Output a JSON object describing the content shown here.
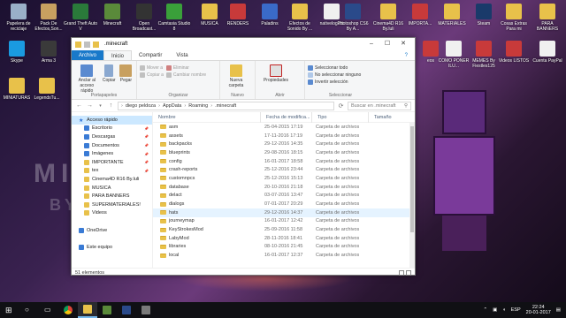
{
  "desktop": {
    "icons": [
      {
        "label": "Papelera de reciclaje",
        "color": "#9ab0c8"
      },
      {
        "label": "Pack De Efectos,Son...",
        "color": "#c8a060"
      },
      {
        "label": "Grand Theft Auto V",
        "color": "#2a7a3a"
      },
      {
        "label": "Minecraft",
        "color": "#5a8a3a"
      },
      {
        "label": "Open Broadcast...",
        "color": "#333333"
      },
      {
        "label": "Camtasia Studio 8",
        "color": "#3aa03a"
      },
      {
        "label": "MUSICA",
        "color": "#e8c14a"
      },
      {
        "label": "RENDERS",
        "color": "#c83a3a"
      },
      {
        "label": "Paladins",
        "color": "#3a6ac8"
      },
      {
        "label": "Efectos de Sonido By ...",
        "color": "#e8c14a"
      },
      {
        "label": "nativelog.txt",
        "color": "#f0f0f0"
      },
      {
        "label": "Photoshop CS6 By A...",
        "color": "#2a4a8a"
      },
      {
        "label": "Cinema4D R16 By.luli",
        "color": "#e8c14a"
      },
      {
        "label": "IMPORTA...",
        "color": "#c83a3a"
      },
      {
        "label": "MATERIALES",
        "color": "#e8c14a"
      },
      {
        "label": "Steam",
        "color": "#1a3a6a"
      },
      {
        "label": "Cosas Extras Para mi",
        "color": "#e8c14a"
      },
      {
        "label": "PARA BANNERS",
        "color": "#e8c14a"
      },
      {
        "label": "Skype",
        "color": "#1a9ae0"
      },
      {
        "label": "Arma 3",
        "color": "#3a3a3a"
      },
      {
        "label": "eos",
        "color": "#c83a3a"
      },
      {
        "label": "COMO PONER ILU...",
        "color": "#f0f0f0"
      },
      {
        "label": "MEMES By Fiestles125",
        "color": "#c83a3a"
      },
      {
        "label": "Videos LISTOS",
        "color": "#c83a3a"
      },
      {
        "label": "Cuenta PayPal",
        "color": "#f0f0f0"
      },
      {
        "label": "MINIATURAS",
        "color": "#e8c14a"
      },
      {
        "label": "LegendsTu...",
        "color": "#e8c14a"
      }
    ],
    "bg_text1": "MI",
    "bg_text2": "BY"
  },
  "window": {
    "title": ".minecraft",
    "controls": [
      "–",
      "☐",
      "✕"
    ],
    "tabs": [
      "Archivo",
      "Inicio",
      "Compartir",
      "Vista"
    ],
    "active_tab": "Inicio",
    "ribbon": {
      "portapapeles": {
        "name": "Portapapeles",
        "pin": "Anclar al acceso rápido",
        "copy": "Copiar",
        "paste": "Pegar",
        "cut": "✂"
      },
      "organizar": {
        "name": "Organizar",
        "move": "Mover a",
        "copy_to": "Copiar a",
        "delete": "Eliminar",
        "rename": "Cambiar nombre"
      },
      "nuevo": {
        "name": "Nuevo",
        "new_folder": "Nueva carpeta"
      },
      "abrir": {
        "name": "Abrir",
        "properties": "Propiedades"
      },
      "seleccionar": {
        "name": "Seleccionar",
        "all": "Seleccionar todo",
        "none": "No seleccionar ninguno",
        "invert": "Invertir selección"
      }
    },
    "address": {
      "segments": [
        "diego peldoza",
        "AppData",
        "Roaming",
        ".minecraft"
      ],
      "search_placeholder": "Buscar en .minecraft"
    },
    "nav": [
      {
        "label": "Acceso rápido",
        "type": "top",
        "sel": true
      },
      {
        "label": "Escritorio",
        "icon": "blue",
        "pin": true
      },
      {
        "label": "Descargas",
        "icon": "blue",
        "pin": true
      },
      {
        "label": "Documentos",
        "icon": "blue",
        "pin": true
      },
      {
        "label": "Imágenes",
        "icon": "blue",
        "pin": true
      },
      {
        "label": "IMPORTANTE",
        "icon": "folder",
        "pin": true
      },
      {
        "label": "tex",
        "icon": "folder",
        "pin": true
      },
      {
        "label": "Cinema4D R16 By.luli",
        "icon": "folder"
      },
      {
        "label": "MUSICA",
        "icon": "folder"
      },
      {
        "label": "PARA BANNERS",
        "icon": "folder"
      },
      {
        "label": "SUPERMATERIALES!",
        "icon": "folder"
      },
      {
        "label": "Videos",
        "icon": "folder"
      },
      {
        "label": "",
        "icon": "none"
      },
      {
        "label": "OneDrive",
        "type": "top",
        "icon": "blue"
      },
      {
        "label": "",
        "icon": "none"
      },
      {
        "label": "Este equipo",
        "type": "top",
        "icon": "blue"
      }
    ],
    "columns": [
      "Nombre",
      "Fecha de modifica...",
      "Tipo",
      "Tamaño"
    ],
    "files": [
      {
        "name": "asm",
        "date": "25-04-2015 17:19",
        "type": "Carpeta de archivos"
      },
      {
        "name": "assets",
        "date": "17-11-2016 17:19",
        "type": "Carpeta de archivos"
      },
      {
        "name": "backpacks",
        "date": "29-12-2016 14:35",
        "type": "Carpeta de archivos"
      },
      {
        "name": "blueprints",
        "date": "29-08-2016 18:15",
        "type": "Carpeta de archivos"
      },
      {
        "name": "config",
        "date": "16-01-2017 18:58",
        "type": "Carpeta de archivos"
      },
      {
        "name": "crash-reports",
        "date": "25-12-2016 23:44",
        "type": "Carpeta de archivos"
      },
      {
        "name": "customnpcs",
        "date": "25-12-2016 15:13",
        "type": "Carpeta de archivos"
      },
      {
        "name": "database",
        "date": "20-10-2016 21:18",
        "type": "Carpeta de archivos"
      },
      {
        "name": "delact",
        "date": "03-07-2016 13:47",
        "type": "Carpeta de archivos"
      },
      {
        "name": "dialogs",
        "date": "07-01-2017 20:29",
        "type": "Carpeta de archivos"
      },
      {
        "name": "hats",
        "date": "29-12-2016 14:37",
        "type": "Carpeta de archivos",
        "hover": true
      },
      {
        "name": "journeymap",
        "date": "16-01-2017 12:42",
        "type": "Carpeta de archivos"
      },
      {
        "name": "KeyStrokesMod",
        "date": "25-09-2016 11:58",
        "type": "Carpeta de archivos"
      },
      {
        "name": "LabyMod",
        "date": "28-11-2016 18:41",
        "type": "Carpeta de archivos"
      },
      {
        "name": "libraries",
        "date": "08-10-2016 21:45",
        "type": "Carpeta de archivos"
      },
      {
        "name": "local",
        "date": "16-01-2017 12:37",
        "type": "Carpeta de archivos"
      }
    ],
    "status": "51 elementos"
  },
  "taskbar": {
    "apps": [
      {
        "name": "start",
        "color": "#ffffff"
      },
      {
        "name": "search",
        "color": "#ffffff"
      },
      {
        "name": "task-view",
        "color": "#ffffff"
      },
      {
        "name": "chrome",
        "color": "#e0c030"
      },
      {
        "name": "file-explorer",
        "color": "#e8c14a"
      },
      {
        "name": "minecraft",
        "color": "#5a8a3a"
      },
      {
        "name": "photoshop",
        "color": "#2a4a8a"
      },
      {
        "name": "other-app",
        "color": "#7a7a7a"
      }
    ],
    "lang": "ESP",
    "time": "22:24",
    "date": "20-01-2017"
  }
}
